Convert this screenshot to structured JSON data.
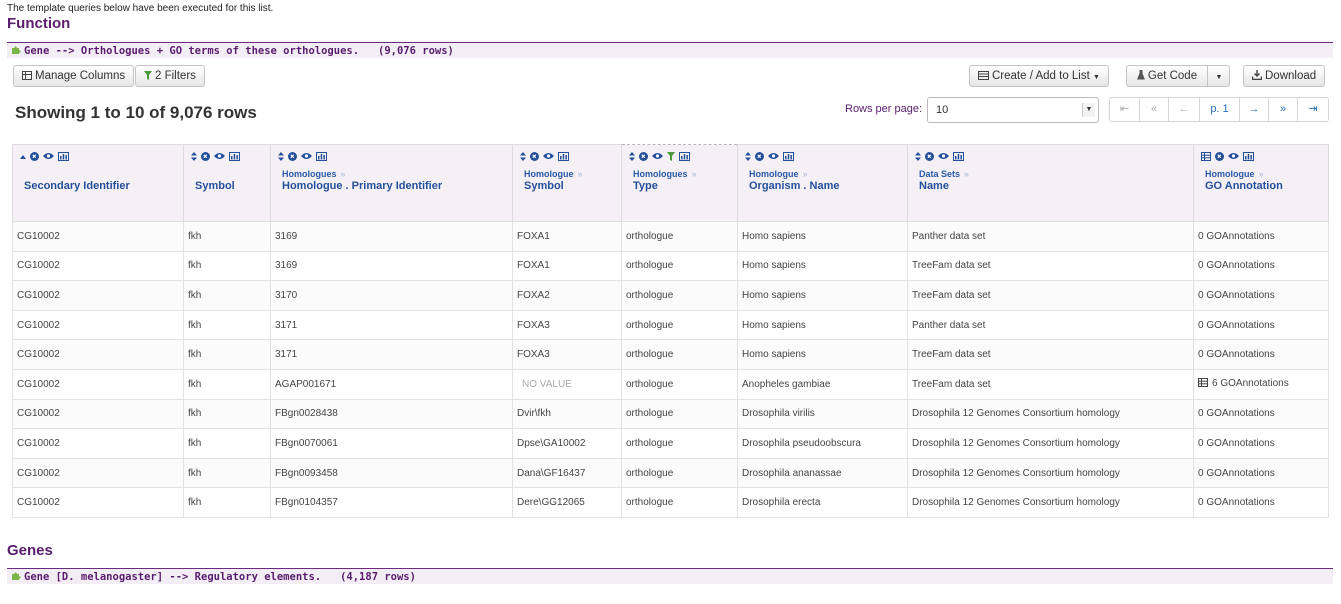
{
  "intro_note": "The template queries below have been executed for this list.",
  "sections": {
    "function_title": "Function",
    "genes_title": "Genes"
  },
  "template_1": {
    "title": "Gene --> Orthologues + GO terms of these orthologues.",
    "count": "(9,076 rows)"
  },
  "template_2": {
    "title": "Gene [D. melanogaster] --> Regulatory elements.",
    "count": "(4,187 rows)"
  },
  "toolbar": {
    "manage_columns": "Manage Columns",
    "filters": "2 Filters",
    "create_list": "Create / Add to List",
    "get_code": "Get Code",
    "download": "Download"
  },
  "summary": "Showing 1 to 10 of 9,076 rows",
  "pagination": {
    "rows_per_page_label": "Rows per page:",
    "rows_per_page_value": "10",
    "first": "⇤",
    "prev_page_group": "«",
    "prev": "←",
    "current": "p. 1",
    "next": "→",
    "next_page_group": "»",
    "last": "⇥"
  },
  "columns": [
    {
      "path": "",
      "name": "Secondary Identifier",
      "sorted": true
    },
    {
      "path": "",
      "name": "Symbol"
    },
    {
      "path": "Homologues",
      "name": "Homologue . Primary Identifier"
    },
    {
      "path": "Homologue",
      "name": "Symbol"
    },
    {
      "path": "Homologues",
      "name": "Type",
      "filtered": true
    },
    {
      "path": "Homologue",
      "name": "Organism . Name"
    },
    {
      "path": "Data Sets",
      "name": "Name"
    },
    {
      "path": "Homologue",
      "name": "GO Annotation",
      "table_icon": true
    }
  ],
  "rows": [
    [
      "CG10002",
      "fkh",
      "3169",
      "FOXA1",
      "orthologue",
      "Homo sapiens",
      "Panther data set",
      "0 GOAnnotations"
    ],
    [
      "CG10002",
      "fkh",
      "3169",
      "FOXA1",
      "orthologue",
      "Homo sapiens",
      "TreeFam data set",
      "0 GOAnnotations"
    ],
    [
      "CG10002",
      "fkh",
      "3170",
      "FOXA2",
      "orthologue",
      "Homo sapiens",
      "TreeFam data set",
      "0 GOAnnotations"
    ],
    [
      "CG10002",
      "fkh",
      "3171",
      "FOXA3",
      "orthologue",
      "Homo sapiens",
      "Panther data set",
      "0 GOAnnotations"
    ],
    [
      "CG10002",
      "fkh",
      "3171",
      "FOXA3",
      "orthologue",
      "Homo sapiens",
      "TreeFam data set",
      "0 GOAnnotations"
    ],
    [
      "CG10002",
      "fkh",
      "AGAP001671",
      "NO VALUE",
      "orthologue",
      "Anopheles gambiae",
      "TreeFam data set",
      "6 GOAnnotations"
    ],
    [
      "CG10002",
      "fkh",
      "FBgn0028438",
      "Dvir\\fkh",
      "orthologue",
      "Drosophila virilis",
      "Drosophila 12 Genomes Consortium homology",
      "0 GOAnnotations"
    ],
    [
      "CG10002",
      "fkh",
      "FBgn0070061",
      "Dpse\\GA10002",
      "orthologue",
      "Drosophila pseudoobscura",
      "Drosophila 12 Genomes Consortium homology",
      "0 GOAnnotations"
    ],
    [
      "CG10002",
      "fkh",
      "FBgn0093458",
      "Dana\\GF16437",
      "orthologue",
      "Drosophila ananassae",
      "Drosophila 12 Genomes Consortium homology",
      "0 GOAnnotations"
    ],
    [
      "CG10002",
      "fkh",
      "FBgn0104357",
      "Dere\\GG12065",
      "orthologue",
      "Drosophila erecta",
      "Drosophila 12 Genomes Consortium homology",
      "0 GOAnnotations"
    ]
  ],
  "colors": {
    "section_purple": "#5a1d6e",
    "header_link_blue": "#244f9a",
    "pager_blue": "#2a6ebb"
  }
}
